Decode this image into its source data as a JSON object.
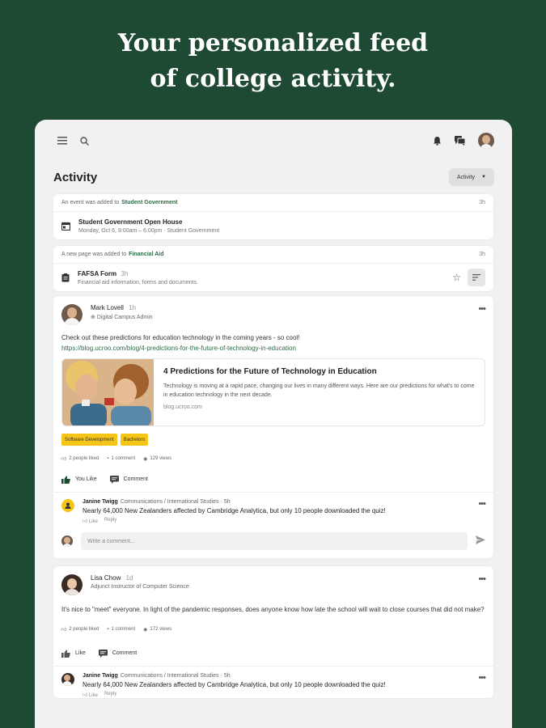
{
  "headline": [
    "Your personalized feed",
    "of college activity."
  ],
  "activity": {
    "title": "Activity",
    "filter_label": "Activity"
  },
  "notice1": {
    "prefix": "An event was added to",
    "link": "Student Government",
    "ago": "3h",
    "title": "Student Government Open House",
    "sub": "Monday, Oct 6, 9:00am – 6:00pm · Student Government"
  },
  "notice2": {
    "prefix": "A new page was added to",
    "link": "Financial Aid",
    "ago": "3h",
    "title": "FAFSA Form",
    "title_ago": "3h",
    "sub": "Financial aid information, forms and documents."
  },
  "post1": {
    "author": "Mark Lovell",
    "ago": "1h",
    "role": "Digital Campus Admin",
    "text": "Check out these predictions for education technology in the coming years - so cool!",
    "url": "https://blog.ucroo.com/blog/4-predictions-for-the-future-of-technology-in-education",
    "link_title": "4 Predictions for the Future of Technology in Education",
    "link_desc": "Technology is moving at a rapid pace, changing our lives in many different ways. Here are our predictions for what's to come in education technology in the next decade.",
    "link_src": "blog.ucroo.com",
    "tags": [
      "Software Development",
      "Bachelors"
    ],
    "likes": "2 people liked",
    "comments": "1 comment",
    "views": "129 views",
    "like_label": "You Like",
    "comment_label": "Comment",
    "comment": {
      "author": "Janine Twigg",
      "meta": "Communications / International Studies · 5h",
      "text": "Nearly 64,000 New Zealanders affected by Cambridge Analytica, but only 10 people downloaded the quiz!",
      "like": "Like",
      "reply": "Reply"
    },
    "write_placeholder": "Write a comment..."
  },
  "post2": {
    "author": "Lisa Chow",
    "ago": "1d",
    "role": "Adjunct Instructor of Computer Science",
    "text": "It's nice to \"meet\" everyone. In light of the pandemic responses, does anyone know how late the school will wait to close courses that did not make?",
    "likes": "2 people liked",
    "comments": "1 comment",
    "views": "172 views",
    "like_label": "Like",
    "comment_label": "Comment",
    "comment": {
      "author": "Janine Twigg",
      "meta": "Communications / International Studies · 5h",
      "text": "Nearly 64,000 New Zealanders affected by Cambridge Analytica, but only 10 people downloaded the quiz!",
      "like": "Like",
      "reply": "Reply"
    }
  },
  "colors": {
    "background": "#1e4a33",
    "accent": "#2f6b48",
    "tag": "#f5c518"
  }
}
